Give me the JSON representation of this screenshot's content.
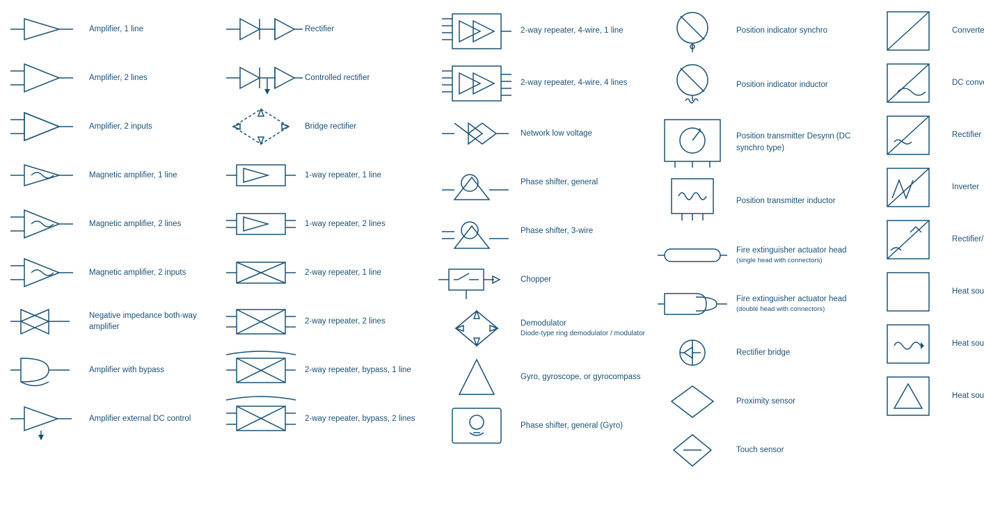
{
  "columns": [
    {
      "id": "col1",
      "items": [
        {
          "id": "amp1",
          "label": "Amplifier, 1 line"
        },
        {
          "id": "amp2",
          "label": "Amplifier, 2 lines"
        },
        {
          "id": "amp3",
          "label": "Amplifier, 2 inputs"
        },
        {
          "id": "mag1",
          "label": "Magnetic amplifier, 1 line"
        },
        {
          "id": "mag2",
          "label": "Magnetic amplifier, 2 lines"
        },
        {
          "id": "mag3",
          "label": "Magnetic amplifier, 2 inputs"
        },
        {
          "id": "neg1",
          "label": "Negative impedance both-way amplifier"
        },
        {
          "id": "amp4",
          "label": "Amplifier with bypass"
        },
        {
          "id": "amp5",
          "label": "Amplifier external DC control"
        }
      ]
    },
    {
      "id": "col2",
      "items": [
        {
          "id": "rect1",
          "label": "Rectifier"
        },
        {
          "id": "rect2",
          "label": "Controlled rectifier"
        },
        {
          "id": "bridge1",
          "label": "Bridge rectifier"
        },
        {
          "id": "rep1",
          "label": "1-way repeater, 1 line"
        },
        {
          "id": "rep2",
          "label": "1-way repeater, 2 lines"
        },
        {
          "id": "rep3",
          "label": "2-way repeater, 1 line"
        },
        {
          "id": "rep4",
          "label": "2-way repeater, 2 lines"
        },
        {
          "id": "rep5",
          "label": "2-way repeater, bypass, 1 line"
        },
        {
          "id": "rep6",
          "label": "2-way repeater, bypass, 2 lines"
        }
      ]
    },
    {
      "id": "col3",
      "items": [
        {
          "id": "rep7",
          "label": "2-way repeater, 4-wire, 1 line"
        },
        {
          "id": "rep8",
          "label": "2-way repeater, 4-wire, 4 lines"
        },
        {
          "id": "net1",
          "label": "Network low voltage"
        },
        {
          "id": "phase1",
          "label": "Phase shifter, general"
        },
        {
          "id": "phase2",
          "label": "Phase shifter, 3-wire"
        },
        {
          "id": "chop1",
          "label": "Chopper"
        },
        {
          "id": "demod1",
          "label": "Demodulator",
          "sublabel": "Diode-type ring demodulator / modulator"
        },
        {
          "id": "gyro1",
          "label": "Gyro, gyroscope, or gyrocompass"
        },
        {
          "id": "phase3",
          "label": "Phase shifter, general (Gyro)"
        }
      ]
    },
    {
      "id": "col4",
      "items": [
        {
          "id": "pos1",
          "label": "Position indicator synchro"
        },
        {
          "id": "pos2",
          "label": "Position indicator inductor"
        },
        {
          "id": "postx1",
          "label": "Position transmitter Desynn (DC synchro type)"
        },
        {
          "id": "postx2",
          "label": "Position transmitter inductor"
        },
        {
          "id": "fire1",
          "label": "Fire extinguisher actuator head",
          "sublabel": "(single head with connectors)"
        },
        {
          "id": "fire2",
          "label": "Fire extinguisher actuator head",
          "sublabel": "(double head with connectors)"
        },
        {
          "id": "rectb1",
          "label": "Rectifier bridge"
        },
        {
          "id": "prox1",
          "label": "Proximity sensor"
        },
        {
          "id": "touch1",
          "label": "Touch sensor"
        }
      ]
    },
    {
      "id": "col5",
      "items": [
        {
          "id": "conv1",
          "label": "Converter, general"
        },
        {
          "id": "dc1",
          "label": "DC converter"
        },
        {
          "id": "rect3",
          "label": "Rectifier"
        },
        {
          "id": "inv1",
          "label": "Inverter"
        },
        {
          "id": "rectinv1",
          "label": "Rectifier/inverter"
        },
        {
          "id": "heat1",
          "label": "Heat source, general"
        },
        {
          "id": "heat2",
          "label": "Heat source, radioisotope"
        },
        {
          "id": "heat3",
          "label": "Heat source, combustion"
        }
      ]
    }
  ]
}
